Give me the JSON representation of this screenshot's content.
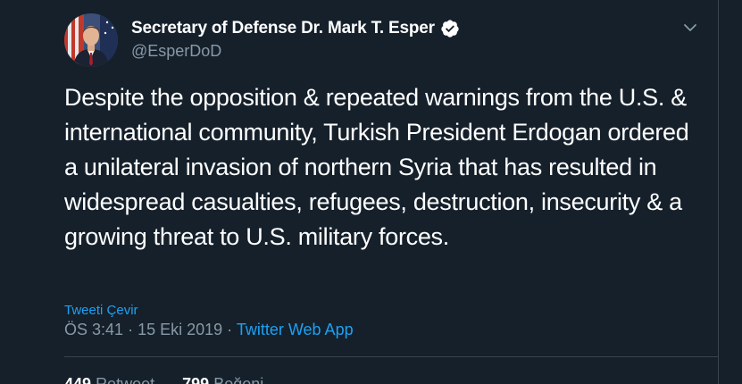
{
  "author": {
    "display_name": "Secretary of Defense Dr. Mark T. Esper",
    "handle": "@EsperDoD",
    "verified": true
  },
  "tweet": {
    "text": "Despite the opposition & repeated warnings from the U.S. & international community, Turkish President Erdogan ordered a unilateral invasion of northern Syria that has resulted in widespread casualties, refugees, destruction, insecurity & a growing threat to U.S. military forces.",
    "translate_label": "Tweeti Çevir",
    "time": "ÖS 3:41",
    "separator": "·",
    "date": "15 Eki 2019",
    "source": "Twitter Web App"
  },
  "stats": {
    "retweets_count": "449",
    "retweets_label": "Retweet",
    "likes_count": "799",
    "likes_label": "Beğeni"
  },
  "icons": {
    "verified": "verified-badge-icon",
    "more": "chevron-down-icon"
  },
  "colors": {
    "background": "#15202b",
    "accent": "#1da1f2",
    "secondary_text": "#8899a6",
    "border": "#38444d"
  }
}
